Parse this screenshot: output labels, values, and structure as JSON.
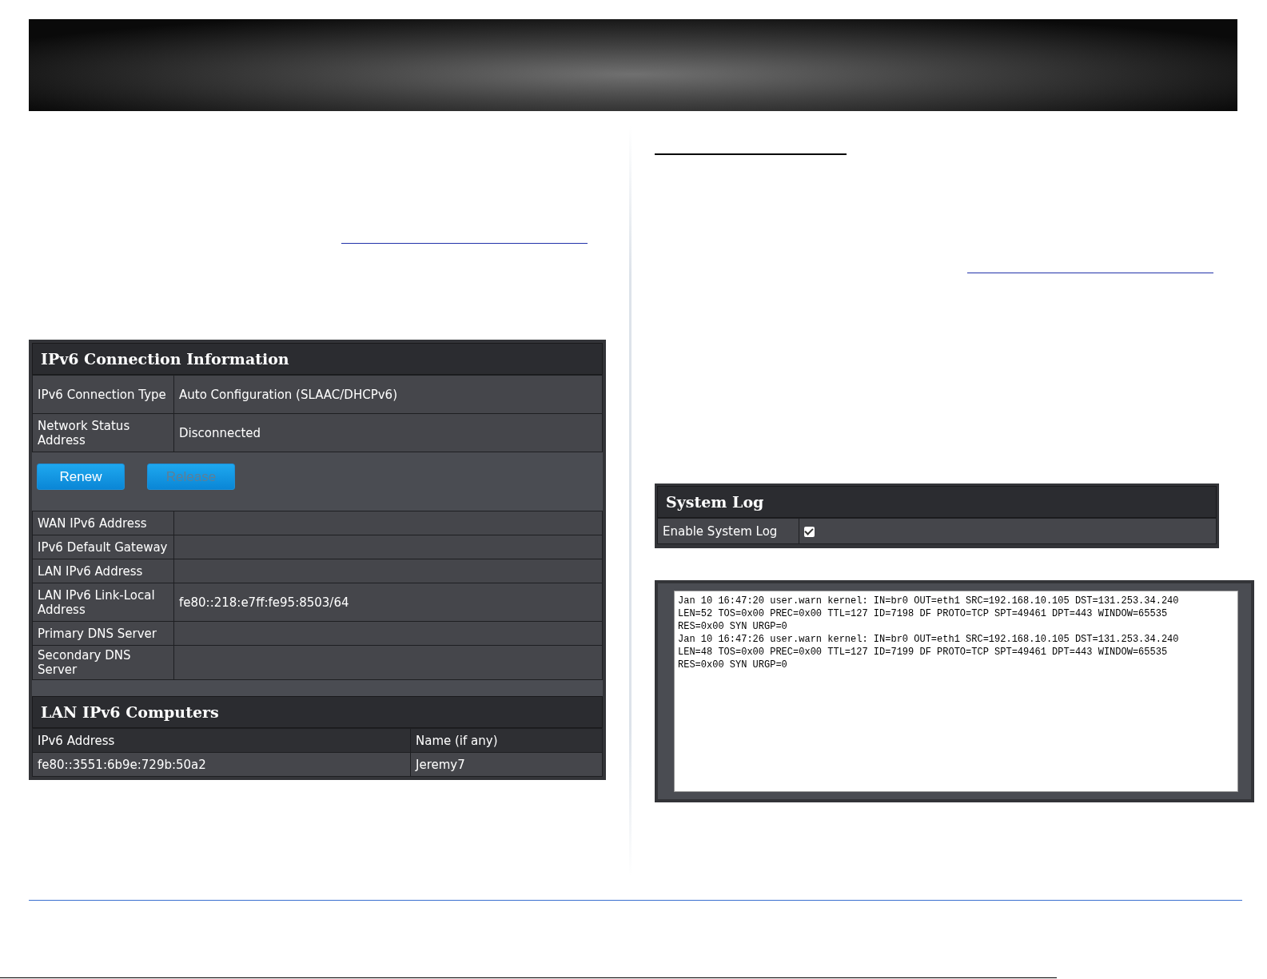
{
  "connection_info": {
    "title": "IPv6 Connection Information",
    "status_rows": [
      {
        "label": "IPv6 Connection Type",
        "value": "Auto Configuration (SLAAC/DHCPv6)"
      },
      {
        "label": "Network Status Address",
        "value": "Disconnected"
      }
    ],
    "buttons": [
      {
        "label": "Renew",
        "disabled": false
      },
      {
        "label": "Release",
        "disabled": true
      }
    ],
    "address_rows": [
      {
        "label": "WAN IPv6 Address"
      },
      {
        "label": "IPv6 Default Gateway"
      },
      {
        "label": "LAN IPv6 Address"
      },
      {
        "label": "LAN IPv6 Link-Local Address",
        "value": "fe80::218:e7ff:fe95:8503/64"
      },
      {
        "label": "Primary DNS Server"
      },
      {
        "label": "Secondary DNS Server"
      }
    ]
  },
  "lan_computers": {
    "title": "LAN IPv6 Computers",
    "columns": [
      "IPv6 Address",
      "Name (if any)"
    ],
    "rows": [
      [
        "fe80::3551:6b9e:729b:50a2",
        "Jeremy7"
      ]
    ]
  },
  "system_log": {
    "title": "System Log",
    "enable_label": "Enable System Log",
    "checked": true,
    "log_lines": [
      "Jan 10 16:47:20 user.warn kernel: IN=br0 OUT=eth1 SRC=192.168.10.105 DST=131.253.34.240",
      "LEN=52 TOS=0x00 PREC=0x00 TTL=127 ID=7198 DF PROTO=TCP SPT=49461 DPT=443 WINDOW=65535",
      "RES=0x00 SYN URGP=0",
      "Jan 10 16:47:26 user.warn kernel: IN=br0 OUT=eth1 SRC=192.168.10.105 DST=131.253.34.240",
      "LEN=48 TOS=0x00 PREC=0x00 TTL=127 ID=7199 DF PROTO=TCP SPT=49461 DPT=443 WINDOW=65535",
      "RES=0x00 SYN URGP=0"
    ]
  }
}
